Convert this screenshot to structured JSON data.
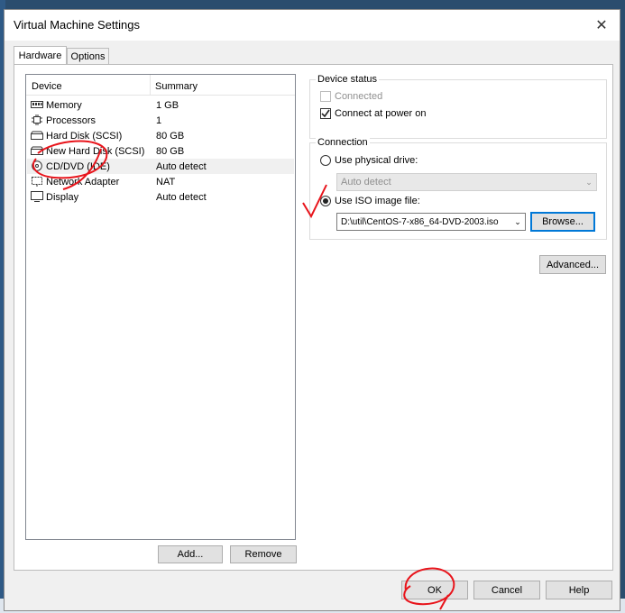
{
  "window": {
    "title": "Virtual Machine Settings"
  },
  "icons": {
    "close": "close-icon"
  },
  "tabs": [
    {
      "label": "Hardware",
      "active": true
    },
    {
      "label": "Options",
      "active": false
    }
  ],
  "device_list": {
    "headers": {
      "device": "Device",
      "summary": "Summary"
    },
    "rows": [
      {
        "name": "Memory",
        "summary": "1 GB",
        "icon": "memory-icon"
      },
      {
        "name": "Processors",
        "summary": "1",
        "icon": "processor-icon"
      },
      {
        "name": "Hard Disk (SCSI)",
        "summary": "80 GB",
        "icon": "hard-disk-icon"
      },
      {
        "name": "New Hard Disk (SCSI)",
        "summary": "80 GB",
        "icon": "hard-disk-icon"
      },
      {
        "name": "CD/DVD (IDE)",
        "summary": "Auto detect",
        "icon": "cd-dvd-icon",
        "selected": true
      },
      {
        "name": "Network Adapter",
        "summary": "NAT",
        "icon": "network-icon"
      },
      {
        "name": "Display",
        "summary": "Auto detect",
        "icon": "display-icon"
      }
    ]
  },
  "list_buttons": {
    "add": "Add...",
    "remove": "Remove"
  },
  "device_status": {
    "title": "Device status",
    "connected": {
      "label": "Connected",
      "checked": false,
      "enabled": false
    },
    "connect_on_power": {
      "label": "Connect at power on",
      "checked": true,
      "enabled": true
    }
  },
  "connection": {
    "title": "Connection",
    "physical": {
      "label": "Use physical drive:",
      "selected": false,
      "value": "Auto detect"
    },
    "iso": {
      "label": "Use ISO image file:",
      "selected": true,
      "value": "D:\\util\\CentOS-7-x86_64-DVD-2003.iso"
    },
    "browse": "Browse..."
  },
  "advanced_button": "Advanced...",
  "footer": {
    "ok": "OK",
    "cancel": "Cancel",
    "help": "Help"
  },
  "annotation_color": "#e8141b"
}
